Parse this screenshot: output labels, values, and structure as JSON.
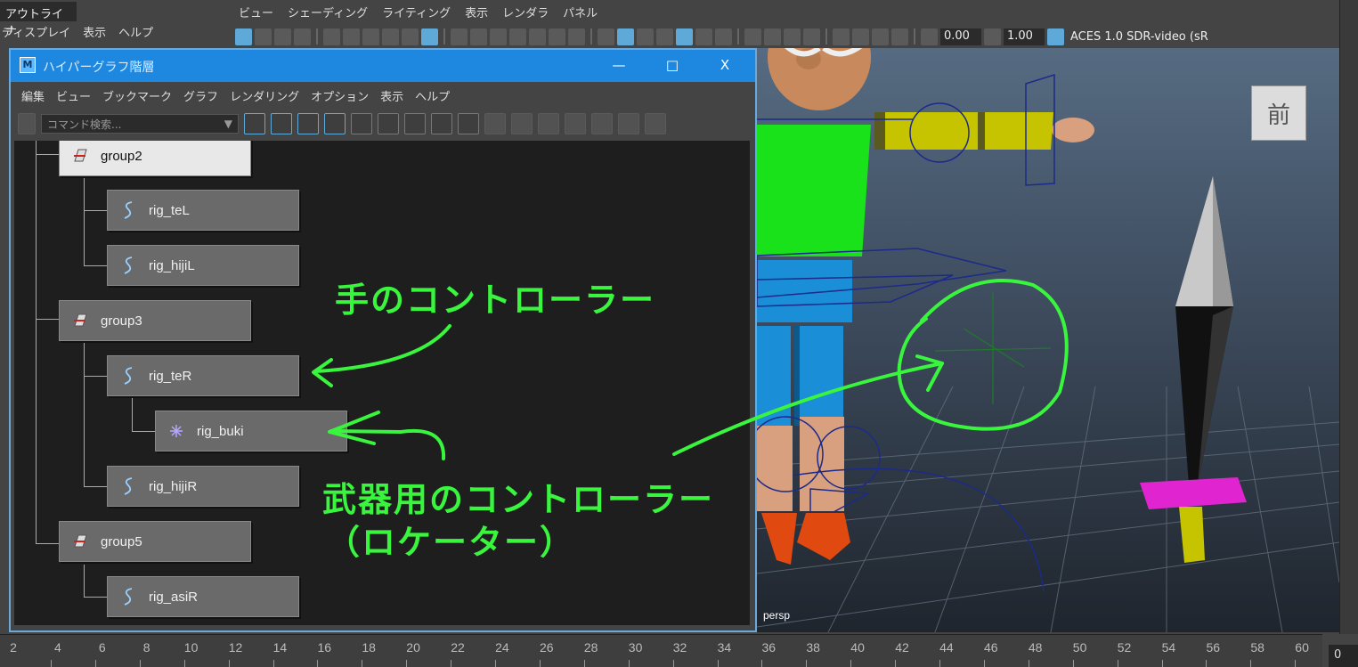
{
  "outliner": {
    "title": "アウトライナ",
    "menu": [
      "ディスプレイ",
      "表示",
      "ヘルプ"
    ]
  },
  "viewport_menu": [
    "ビュー",
    "シェーディング",
    "ライティング",
    "表示",
    "レンダラ",
    "パネル"
  ],
  "viewport_toolbar": {
    "value_a": "0.00",
    "value_b": "1.00",
    "color_management": "ACES 1.0 SDR-video (sR"
  },
  "viewport": {
    "camera_label": "persp",
    "view_cube_label": "前"
  },
  "hypergraph": {
    "title": "ハイパーグラフ階層",
    "window_buttons": [
      "—",
      "□",
      "X"
    ],
    "menu": [
      "編集",
      "ビュー",
      "ブックマーク",
      "グラフ",
      "レンダリング",
      "オプション",
      "表示",
      "ヘルプ"
    ],
    "search_placeholder": "コマンド検索...",
    "nodes": [
      {
        "name": "group2",
        "type": "group",
        "selected": true
      },
      {
        "name": "rig_teL",
        "type": "curve"
      },
      {
        "name": "rig_hijiL",
        "type": "curve"
      },
      {
        "name": "group3",
        "type": "group"
      },
      {
        "name": "rig_teR",
        "type": "curve"
      },
      {
        "name": "rig_buki",
        "type": "locator"
      },
      {
        "name": "rig_hijiR",
        "type": "curve"
      },
      {
        "name": "group5",
        "type": "group"
      },
      {
        "name": "rig_asiR",
        "type": "curve"
      }
    ]
  },
  "annotations": {
    "hand_controller": "手のコントローラー",
    "weapon_controller": "武器用のコントローラー",
    "locator_note": "（ロケーター）",
    "color": "#39f53d"
  },
  "timeline": {
    "ticks": [
      "2",
      "4",
      "6",
      "8",
      "10",
      "12",
      "14",
      "16",
      "18",
      "20",
      "22",
      "24",
      "26",
      "28",
      "30",
      "32",
      "34",
      "36",
      "38",
      "40",
      "42",
      "44",
      "46",
      "48",
      "50",
      "52",
      "54",
      "56",
      "58",
      "60"
    ],
    "current_frame": "0"
  }
}
